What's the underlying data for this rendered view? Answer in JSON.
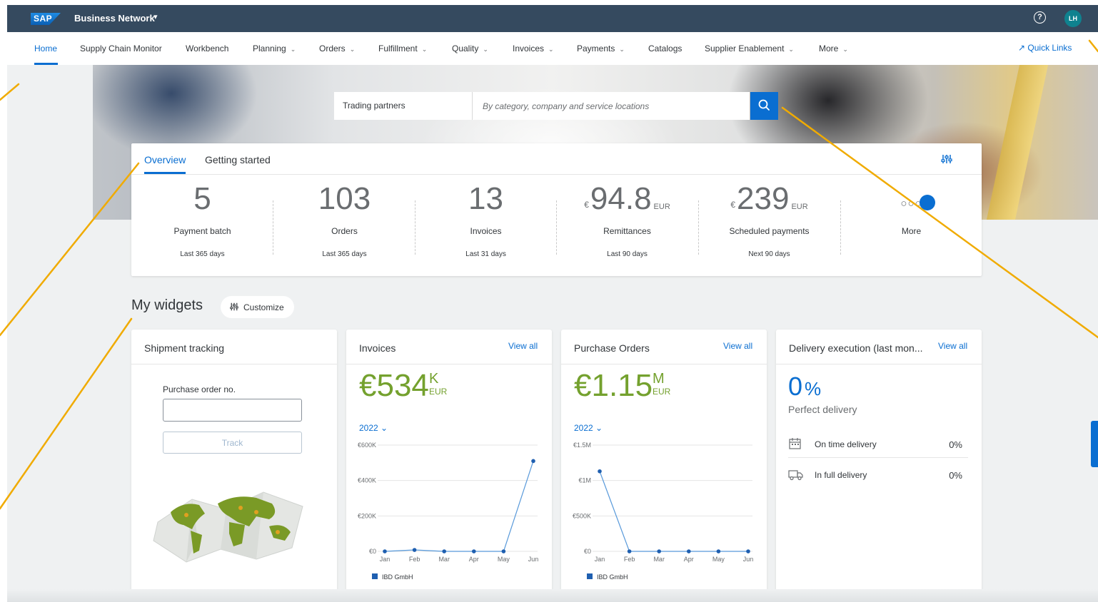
{
  "shell": {
    "logo": "SAP",
    "title": "Business Network",
    "help_icon": "help-circle-icon",
    "avatar_initials": "LH"
  },
  "nav": {
    "items": [
      {
        "label": "Home",
        "active": true,
        "dropdown": false
      },
      {
        "label": "Supply Chain Monitor",
        "dropdown": false
      },
      {
        "label": "Workbench",
        "dropdown": false
      },
      {
        "label": "Planning",
        "dropdown": true
      },
      {
        "label": "Orders",
        "dropdown": true
      },
      {
        "label": "Fulfillment",
        "dropdown": true
      },
      {
        "label": "Quality",
        "dropdown": true
      },
      {
        "label": "Invoices",
        "dropdown": true
      },
      {
        "label": "Payments",
        "dropdown": true
      },
      {
        "label": "Catalogs",
        "dropdown": false
      },
      {
        "label": "Supplier Enablement",
        "dropdown": true
      },
      {
        "label": "More",
        "dropdown": true
      }
    ],
    "quick_links": "Quick Links"
  },
  "search": {
    "scope": "Trading partners",
    "placeholder": "By category, company and service locations"
  },
  "overview": {
    "tabs": [
      "Overview",
      "Getting started"
    ],
    "active_tab": "Overview",
    "kpis": [
      {
        "value": "5",
        "currency": "",
        "unit": "",
        "label": "Payment batch",
        "period": "Last 365 days"
      },
      {
        "value": "103",
        "currency": "",
        "unit": "",
        "label": "Orders",
        "period": "Last 365 days"
      },
      {
        "value": "13",
        "currency": "",
        "unit": "",
        "label": "Invoices",
        "period": "Last 31 days"
      },
      {
        "value": "94.8",
        "currency": "€",
        "unit": "EUR",
        "label": "Remittances",
        "period": "Last 90 days"
      },
      {
        "value": "239",
        "currency": "€",
        "unit": "EUR",
        "label": "Scheduled payments",
        "period": "Next 90 days"
      }
    ],
    "more": {
      "label": "More"
    }
  },
  "widgets": {
    "title": "My widgets",
    "customize": "Customize",
    "shipment": {
      "title": "Shipment tracking",
      "po_label": "Purchase order no.",
      "po_value": "",
      "track": "Track"
    },
    "invoices": {
      "title": "Invoices",
      "view_all": "View all",
      "value": "€534",
      "suffix": "K",
      "currency": "EUR",
      "year": "2022"
    },
    "purchase_orders": {
      "title": "Purchase Orders",
      "view_all": "View all",
      "value": "€1.15",
      "suffix": "M",
      "currency": "EUR",
      "year": "2022"
    },
    "delivery": {
      "title": "Delivery execution (last mon...",
      "view_all": "View all",
      "pct": "0",
      "pct_sign": "%",
      "label": "Perfect delivery",
      "rows": [
        {
          "icon": "calendar-icon",
          "label": "On time delivery",
          "value": "0%"
        },
        {
          "icon": "truck-icon",
          "label": "In full delivery",
          "value": "0%"
        }
      ]
    }
  },
  "chart_data": [
    {
      "type": "line",
      "title": "",
      "categories": [
        "Jan",
        "Feb",
        "Mar",
        "Apr",
        "May",
        "Jun"
      ],
      "ylim": [
        0,
        600000
      ],
      "yticks": [
        "€0",
        "€200K",
        "€400K",
        "€600K"
      ],
      "series": [
        {
          "name": "IBD GmbH",
          "values": [
            0,
            8000,
            0,
            0,
            0,
            510000
          ]
        }
      ]
    },
    {
      "type": "line",
      "title": "",
      "categories": [
        "Jan",
        "Feb",
        "Mar",
        "Apr",
        "May",
        "Jun"
      ],
      "ylim": [
        0,
        1500000
      ],
      "yticks": [
        "€0",
        "€500K",
        "€1M",
        "€1.5M"
      ],
      "series": [
        {
          "name": "IBD GmbH",
          "values": [
            1130000,
            0,
            0,
            0,
            0,
            0
          ]
        }
      ]
    }
  ],
  "colors": {
    "shell": "#354a5f",
    "accent": "#0a6ed1",
    "kpi_green": "#74a12e",
    "annotation": "#f0ab00"
  }
}
